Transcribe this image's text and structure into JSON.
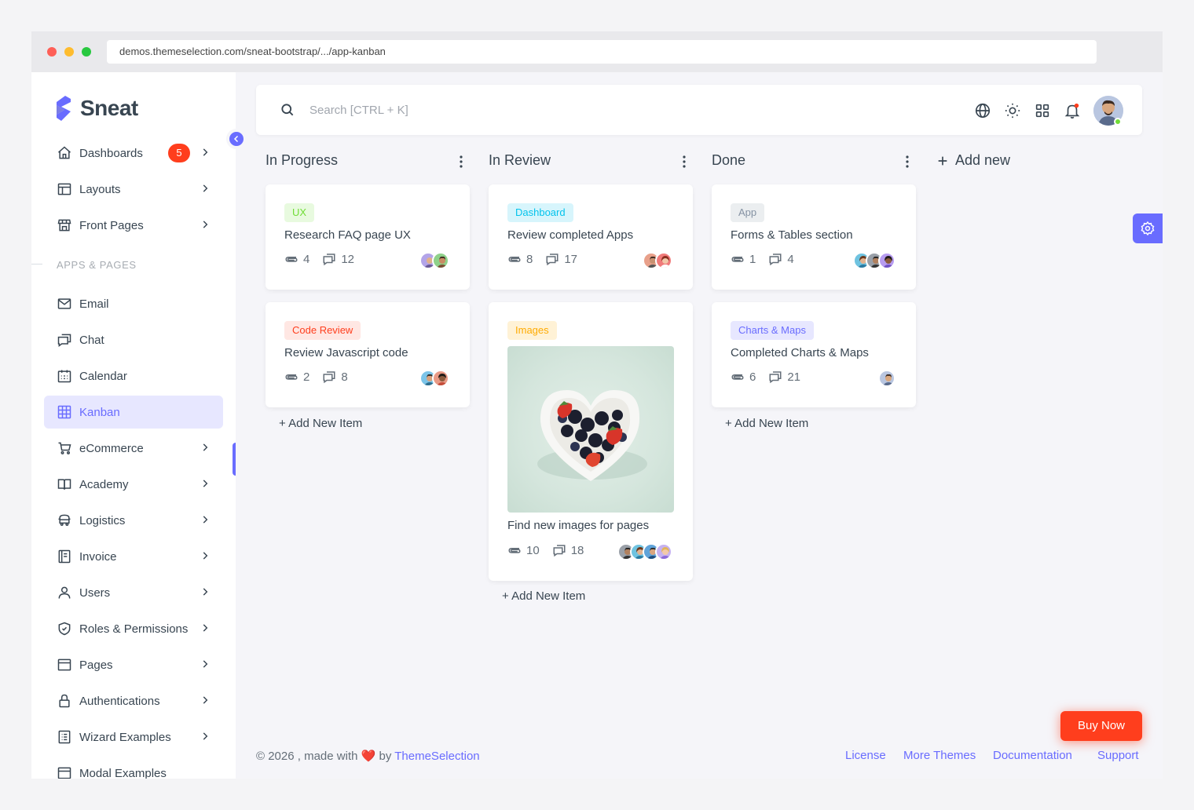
{
  "browser": {
    "url": "demos.themeselection.com/sneat-bootstrap/.../app-kanban"
  },
  "brand": {
    "name": "Sneat"
  },
  "sidebar": {
    "items": [
      {
        "label": "Dashboards",
        "badge": "5"
      },
      {
        "label": "Layouts"
      },
      {
        "label": "Front Pages"
      }
    ],
    "section_label": "APPS & PAGES",
    "apps": [
      {
        "label": "Email"
      },
      {
        "label": "Chat"
      },
      {
        "label": "Calendar"
      },
      {
        "label": "Kanban"
      },
      {
        "label": "eCommerce"
      },
      {
        "label": "Academy"
      },
      {
        "label": "Logistics"
      },
      {
        "label": "Invoice"
      },
      {
        "label": "Users"
      },
      {
        "label": "Roles & Permissions"
      },
      {
        "label": "Pages"
      },
      {
        "label": "Authentications"
      },
      {
        "label": "Wizard Examples"
      },
      {
        "label": "Modal Examples"
      }
    ]
  },
  "navbar": {
    "search_placeholder": "Search [CTRL + K]"
  },
  "board": {
    "add_new": "Add new",
    "add_item": "+ Add New Item",
    "columns": [
      {
        "title": "In Progress",
        "cards": [
          {
            "tag": "UX",
            "title": "Research FAQ page UX",
            "attachments": "4",
            "comments": "12"
          },
          {
            "tag": "Code Review",
            "title": "Review Javascript code",
            "attachments": "2",
            "comments": "8"
          }
        ]
      },
      {
        "title": "In Review",
        "cards": [
          {
            "tag": "Dashboard",
            "title": "Review completed Apps",
            "attachments": "8",
            "comments": "17"
          },
          {
            "tag": "Images",
            "title": "Find new images for pages",
            "attachments": "10",
            "comments": "18"
          }
        ]
      },
      {
        "title": "Done",
        "cards": [
          {
            "tag": "App",
            "title": "Forms & Tables section",
            "attachments": "1",
            "comments": "4"
          },
          {
            "tag": "Charts & Maps",
            "title": "Completed Charts & Maps",
            "attachments": "6",
            "comments": "21"
          }
        ]
      }
    ]
  },
  "footer": {
    "copyright": "© 2026 , made with",
    "by": "by",
    "company": "ThemeSelection",
    "links": [
      "License",
      "More Themes",
      "Documentation",
      "Support"
    ]
  },
  "buy_now": "Buy Now",
  "colors": {
    "primary": "#696cff",
    "danger": "#ff3e1d",
    "success": "#71dd37",
    "info": "#03c3ec",
    "warning": "#ffab00",
    "secondary": "#8592a3"
  }
}
